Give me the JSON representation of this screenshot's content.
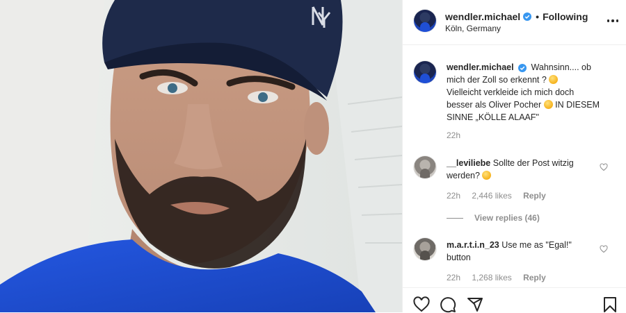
{
  "header": {
    "username": "wendler.michael",
    "follow_status": "Following",
    "location": "Köln, Germany"
  },
  "caption": {
    "username": "wendler.michael",
    "line1": "Wahnsinn.... ob",
    "line2": "mich der Zoll so erkennt ?",
    "line3": "Vielleicht verkleide ich mich doch",
    "line4": "besser als Oliver Pocher",
    "line4b": "IN DIESEM",
    "line5": "SINNE „KÖLLE ALAAF\"",
    "time": "22h"
  },
  "comments": [
    {
      "username": "__leviliebe",
      "line1": "Sollte der Post witzig",
      "line2": "werden?",
      "time": "22h",
      "likes": "2,446 likes",
      "reply": "Reply",
      "view_replies": "View replies (46)"
    },
    {
      "username": "m.a.r.t.i.n_23",
      "line1": "Use me as \"Egal!\"",
      "line2": "button",
      "time": "22h",
      "likes": "1,268 likes",
      "reply": "Reply"
    }
  ],
  "icons": [
    "verified-badge-icon",
    "more-options-icon",
    "heart-icon",
    "comment-icon",
    "share-icon",
    "bookmark-icon",
    "small-heart-icon"
  ],
  "colors": {
    "verified_blue": "#3897f0",
    "text": "#262626",
    "muted": "#8e8e8e",
    "shirt_blue": "#1f4fd6",
    "cap_navy": "#1e2a4a"
  }
}
